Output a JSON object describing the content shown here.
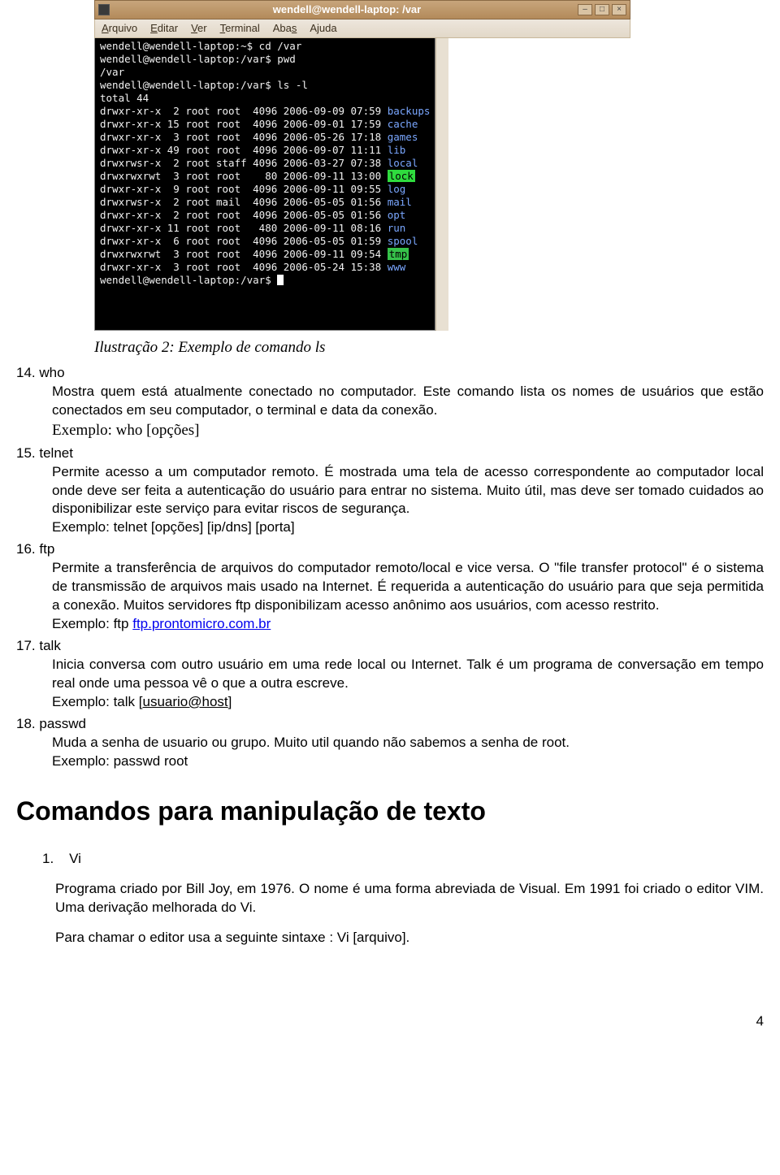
{
  "terminal": {
    "title": "wendell@wendell-laptop: /var",
    "menu": [
      "Arquivo",
      "Editar",
      "Ver",
      "Terminal",
      "Abas",
      "Ajuda"
    ],
    "underline_idx": [
      0,
      0,
      0,
      0,
      3,
      1
    ],
    "lines": [
      {
        "t": "wendell@wendell-laptop:~$ cd /var"
      },
      {
        "t": "wendell@wendell-laptop:/var$ pwd"
      },
      {
        "t": "/var"
      },
      {
        "t": "wendell@wendell-laptop:/var$ ls -l"
      },
      {
        "t": "total 44"
      },
      {
        "t": "drwxr-xr-x  2 root root  4096 2006-09-09 07:59 ",
        "suffix": "backups",
        "cls": "c-blue"
      },
      {
        "t": "drwxr-xr-x 15 root root  4096 2006-09-01 17:59 ",
        "suffix": "cache",
        "cls": "c-blue"
      },
      {
        "t": "drwxr-xr-x  3 root root  4096 2006-05-26 17:18 ",
        "suffix": "games",
        "cls": "c-blue"
      },
      {
        "t": "drwxr-xr-x 49 root root  4096 2006-09-07 11:11 ",
        "suffix": "lib",
        "cls": "c-blue"
      },
      {
        "t": "drwxrwsr-x  2 root staff 4096 2006-03-27 07:38 ",
        "suffix": "local",
        "cls": "c-blue"
      },
      {
        "t": "drwxrwxrwt  3 root root    80 2006-09-11 13:00 ",
        "suffix": "lock",
        "cls": "c-hl1"
      },
      {
        "t": "drwxr-xr-x  9 root root  4096 2006-09-11 09:55 ",
        "suffix": "log",
        "cls": "c-blue"
      },
      {
        "t": "drwxrwsr-x  2 root mail  4096 2006-05-05 01:56 ",
        "suffix": "mail",
        "cls": "c-blue"
      },
      {
        "t": "drwxr-xr-x  2 root root  4096 2006-05-05 01:56 ",
        "suffix": "opt",
        "cls": "c-blue"
      },
      {
        "t": "drwxr-xr-x 11 root root   480 2006-09-11 08:16 ",
        "suffix": "run",
        "cls": "c-blue"
      },
      {
        "t": "drwxr-xr-x  6 root root  4096 2006-05-05 01:59 ",
        "suffix": "spool",
        "cls": "c-blue"
      },
      {
        "t": "drwxrwxrwt  3 root root  4096 2006-09-11 09:54 ",
        "suffix": "tmp",
        "cls": "c-hl2"
      },
      {
        "t": "drwxr-xr-x  3 root root  4096 2006-05-24 15:38 ",
        "suffix": "www",
        "cls": "c-blue"
      },
      {
        "t": "wendell@wendell-laptop:/var$ ",
        "cursor": true
      }
    ]
  },
  "caption": "Ilustração 2: Exemplo de comando ls",
  "items": [
    {
      "n": "14.",
      "title": "who",
      "body": "Mostra quem está atualmente conectado no computador. Este comando lista os nomes de usuários que estão conectados em seu computador, o terminal e data da conexão.",
      "example": "Exemplo: who [opções]",
      "example_serif": true
    },
    {
      "n": "15.",
      "title": "telnet",
      "body": "Permite acesso a um computador remoto. É mostrada uma tela de acesso correspondente ao computador local onde deve ser feita a autenticação do usuário para entrar no sistema. Muito útil, mas deve ser tomado cuidados ao disponibilizar este serviço para evitar riscos de segurança.",
      "example": "Exemplo: telnet [opções] [ip/dns] [porta]"
    },
    {
      "n": "16.",
      "title": "ftp",
      "body": "Permite a transferência de arquivos do computador remoto/local e vice versa. O \"file transfer protocol\" é o sistema de transmissão de arquivos mais usado na Internet. É requerida a autenticação do usuário para que seja permitida a conexão. Muitos servidores ftp disponibilizam acesso anônimo aos usuários, com acesso restrito.",
      "example_prefix": "Exemplo: ftp ",
      "example_link": "ftp.prontomicro.com.br"
    },
    {
      "n": "17.",
      "title": "talk",
      "body": "Inicia conversa com outro usuário em uma rede local ou Internet. Talk é um programa de conversação em tempo real onde uma pessoa vê o que a outra escreve.",
      "example_prefix": "Exemplo: talk [",
      "example_uline": "usuario@host",
      "example_suffix": "]"
    },
    {
      "n": "18.",
      "title": "passwd",
      "body": "Muda a senha de usuario ou grupo. Muito util quando não sabemos a senha de root.",
      "example": "Exemplo: passwd root"
    }
  ],
  "section_heading": "Comandos para manipulação de texto",
  "sub": {
    "n": "1.",
    "title": "Vi",
    "p1": "Programa criado por Bill Joy, em 1976. O nome é uma forma abreviada de Visual. Em 1991 foi criado o editor VIM. Uma derivação melhorada do Vi.",
    "p2": "Para chamar o editor usa a seguinte sintaxe : Vi [arquivo]."
  },
  "pagenum": "4"
}
